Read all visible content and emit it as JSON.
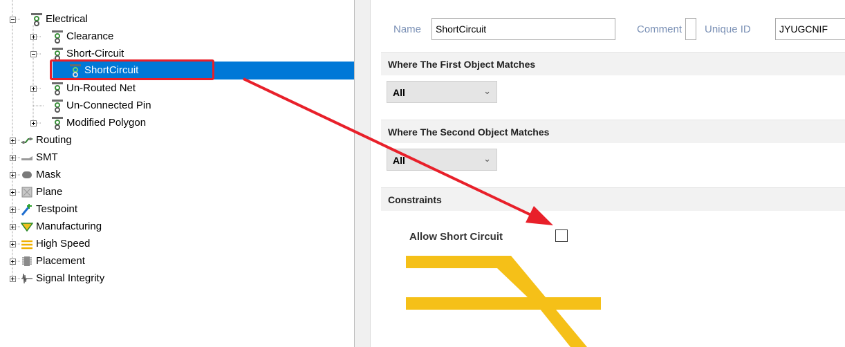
{
  "tree": {
    "nodes": [
      {
        "label": "Electrical"
      },
      {
        "label": "Clearance"
      },
      {
        "label": "Short-Circuit"
      },
      {
        "label": "ShortCircuit"
      },
      {
        "label": "Un-Routed Net"
      },
      {
        "label": "Un-Connected Pin"
      },
      {
        "label": "Modified Polygon"
      },
      {
        "label": "Routing"
      },
      {
        "label": "SMT"
      },
      {
        "label": "Mask"
      },
      {
        "label": "Plane"
      },
      {
        "label": "Testpoint"
      },
      {
        "label": "Manufacturing"
      },
      {
        "label": "High Speed"
      },
      {
        "label": "Placement"
      },
      {
        "label": "Signal Integrity"
      }
    ]
  },
  "rule": {
    "name_label": "Name",
    "name_value": "ShortCircuit",
    "comment_label": "Comment",
    "comment_value": "",
    "uid_label": "Unique ID",
    "uid_value": "JYUGCNIF"
  },
  "first_match": {
    "title": "Where The First Object Matches",
    "selected": "All"
  },
  "second_match": {
    "title": "Where The Second Object Matches",
    "selected": "All"
  },
  "constraints": {
    "title": "Constraints",
    "allow_label": "Allow Short Circuit",
    "allow_checked": false
  },
  "colors": {
    "selection": "#0078d7",
    "highlight": "#e8202a",
    "arrow": "#e8202a",
    "track": "#f5c018"
  }
}
